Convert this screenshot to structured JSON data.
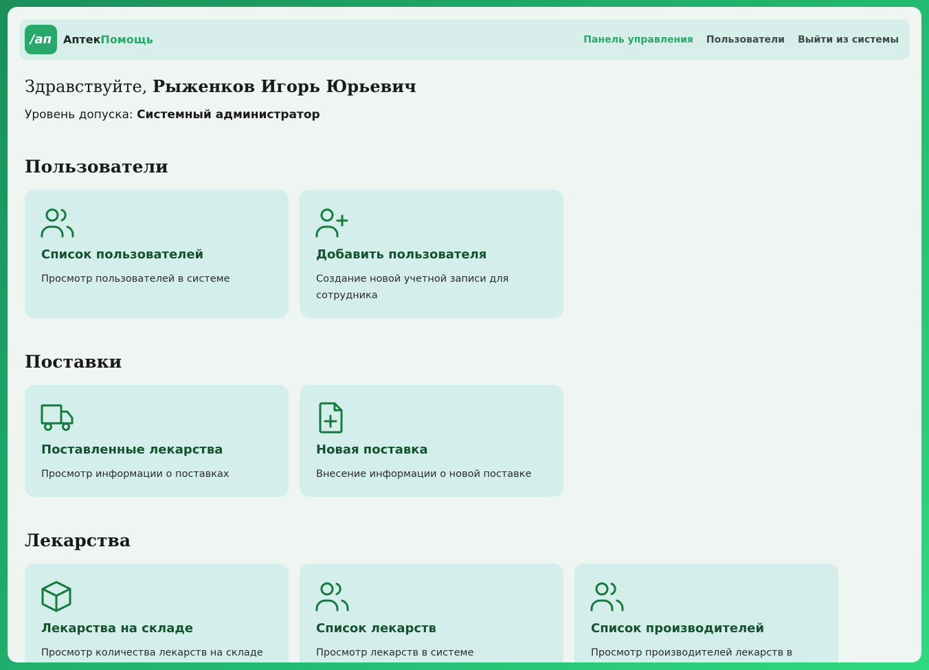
{
  "brand": {
    "logo_text": "/ап",
    "name_part1": "Аптек",
    "name_part2": "Помощь",
    "accent_color": "#2aa76a"
  },
  "nav": {
    "dashboard": "Панель управления",
    "users": "Пользователи",
    "logout": "Выйти из системы"
  },
  "greeting": {
    "prefix": "Здравствуйте, ",
    "name": "Рыженков Игорь Юрьевич"
  },
  "access": {
    "label": "Уровень допуска: ",
    "value": "Системный администратор"
  },
  "sections": {
    "users": {
      "title": "Пользователи",
      "cards": [
        {
          "icon": "users-icon",
          "title": "Список пользователей",
          "desc": "Просмотр пользователей в системе"
        },
        {
          "icon": "user-plus-icon",
          "title": "Добавить пользователя",
          "desc": "Создание новой учетной записи для сотрудника"
        }
      ]
    },
    "supplies": {
      "title": "Поставки",
      "cards": [
        {
          "icon": "truck-icon",
          "title": "Поставленные лекарства",
          "desc": "Просмотр информации о поставках"
        },
        {
          "icon": "file-plus-icon",
          "title": "Новая поставка",
          "desc": "Внесение информации о новой поставке"
        }
      ]
    },
    "medicines": {
      "title": "Лекарства",
      "cards": [
        {
          "icon": "box-icon",
          "title": "Лекарства на складе",
          "desc": "Просмотр количества лекарств на складе"
        },
        {
          "icon": "users-icon",
          "title": "Список лекарств",
          "desc": "Просмотр лекарств в системе"
        },
        {
          "icon": "users-icon",
          "title": "Список производителей",
          "desc": "Просмотр производителей лекарств в"
        }
      ]
    }
  }
}
